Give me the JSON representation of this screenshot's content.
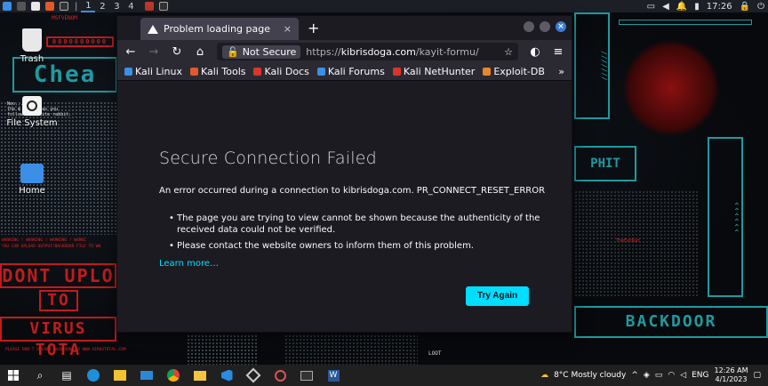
{
  "top_panel": {
    "workspaces": [
      "1",
      "2",
      "3",
      "4"
    ],
    "clock": "17:26"
  },
  "desktop": {
    "icons": [
      {
        "label": "Trash",
        "icon": "trash-icon"
      },
      {
        "label": "File System",
        "icon": "drive-icon"
      },
      {
        "label": "Home",
        "icon": "home-folder-icon"
      }
    ],
    "wallpaper_text": {
      "msfvenom": "MSFVENOM",
      "warning": "WARNING ! WARNING ! WARNING ! WARNI\nYOU CAN UPLOAD OUTPUT/BACKDOOR FILE TO WW",
      "dont_upload": "DONT UPLO",
      "to": "TO",
      "virus_total": "VIRUS TOTA",
      "please": "PLEASE DON'T UPLOAD BACKDOOR TO WWW.VIRUSTOTAL.COM",
      "neo": "Neo...\nthe m       has you\nfollow the white rabbit.",
      "loot": "LOOT",
      "the_fat_rat": "TheFatRat",
      "che": "Chea",
      "backdoor": "BACKDOOR"
    }
  },
  "browser": {
    "tab_title": "Problem loading page",
    "not_secure_label": "Not Secure",
    "url_prefix": "https://",
    "url_host": "kibrisdoga.com",
    "url_path": "/kayit-formu/",
    "bookmarks": [
      {
        "label": "Kali Linux",
        "color": "#3b8fe6"
      },
      {
        "label": "Kali Tools",
        "color": "#e05a2b"
      },
      {
        "label": "Kali Docs",
        "color": "#d9352b"
      },
      {
        "label": "Kali Forums",
        "color": "#3b8fe6"
      },
      {
        "label": "Kali NetHunter",
        "color": "#d9352b"
      },
      {
        "label": "Exploit-DB",
        "color": "#e8862a"
      }
    ],
    "error": {
      "title": "Secure Connection Failed",
      "description": "An error occurred during a connection to kibrisdoga.com. PR_CONNECT_RESET_ERROR",
      "bullets": [
        "The page you are trying to view cannot be shown because the authenticity of the received data could not be verified.",
        "Please contact the website owners to inform them of this problem."
      ],
      "learn_more": "Learn more…",
      "try_again": "Try Again"
    }
  },
  "taskbar": {
    "weather": "8°C  Mostly cloudy",
    "language": "ENG",
    "time": "12:26 AM",
    "date": "4/1/2023"
  }
}
